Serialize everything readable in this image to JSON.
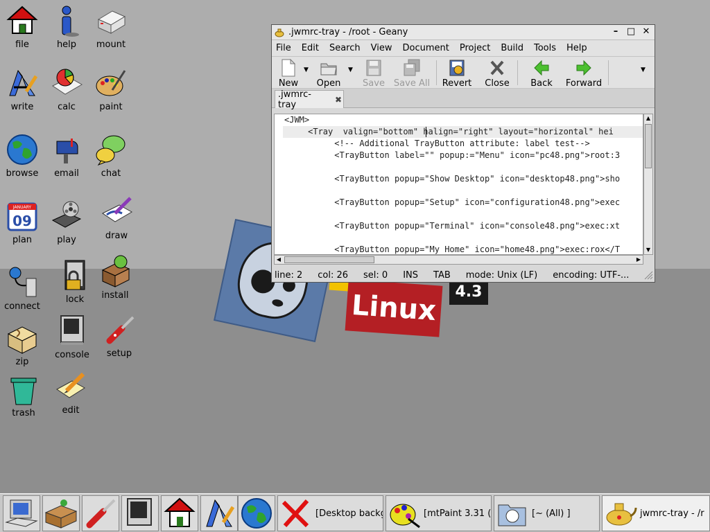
{
  "desktop": {
    "wallpaper": {
      "brand": "Linux",
      "version": "4.3"
    },
    "icons": [
      {
        "label": "file",
        "icon": "home-icon"
      },
      {
        "label": "help",
        "icon": "info-icon"
      },
      {
        "label": "mount",
        "icon": "drive-icon"
      },
      {
        "label": "write",
        "icon": "write-icon"
      },
      {
        "label": "calc",
        "icon": "calc-icon"
      },
      {
        "label": "paint",
        "icon": "palette-icon"
      },
      {
        "label": "browse",
        "icon": "globe-icon"
      },
      {
        "label": "email",
        "icon": "mailbox-icon"
      },
      {
        "label": "chat",
        "icon": "chat-bubble-icon"
      },
      {
        "label": "plan",
        "icon": "calendar-icon"
      },
      {
        "label": "play",
        "icon": "film-reel-icon"
      },
      {
        "label": "draw",
        "icon": "draw-icon"
      },
      {
        "label": "connect",
        "icon": "connect-icon"
      },
      {
        "label": "lock",
        "icon": "lock-icon"
      },
      {
        "label": "install",
        "icon": "install-icon"
      },
      {
        "label": "zip",
        "icon": "package-icon"
      },
      {
        "label": "console",
        "icon": "monitor-icon"
      },
      {
        "label": "setup",
        "icon": "knife-icon"
      },
      {
        "label": "trash",
        "icon": "trash-icon"
      },
      {
        "label": "edit",
        "icon": "edit-icon"
      }
    ],
    "calendar_date": "09",
    "calendar_month": "JANUARY"
  },
  "window": {
    "title": ".jwmrc-tray - /root - Geany",
    "menu": [
      "File",
      "Edit",
      "Search",
      "View",
      "Document",
      "Project",
      "Build",
      "Tools",
      "Help"
    ],
    "toolbar": {
      "new": "New",
      "open": "Open",
      "save": "Save",
      "save_all": "Save All",
      "revert": "Revert",
      "close": "Close",
      "back": "Back",
      "forward": "Forward"
    },
    "tab_label": ".jwmrc-tray",
    "editor_lines": [
      "<JWM>",
      "     <Tray  valign=\"bottom\" halign=\"right\" layout=\"horizontal\" hei",
      "          <!-- Additional TrayButton attribute: label test-->",
      "          <TrayButton label=\"\" popup:=\"Menu\" icon=\"pc48.png\">root:3",
      "",
      "          <TrayButton popup=\"Show Desktop\" icon=\"desktop48.png\">sho",
      "",
      "          <TrayButton popup=\"Setup\" icon=\"configuration48.png\">exec",
      "",
      "          <TrayButton popup=\"Terminal\" icon=\"console48.png\">exec:xt",
      "",
      "          <TrayButton popup=\"My Home\" icon=\"home48.png\">exec:rox</T"
    ],
    "status": {
      "line": "line: 2",
      "col": "col: 26",
      "sel": "sel: 0",
      "mode_ins": "INS",
      "tab": "TAB",
      "mode": "mode: Unix (LF)",
      "encoding": "encoding: UTF-..."
    }
  },
  "taskbar": {
    "launchers": [
      "computer-icon",
      "desk-icon",
      "knife-icon",
      "monitor-icon",
      "home-icon",
      "write-icon",
      "globe-icon"
    ],
    "tasks": [
      {
        "label": "[Desktop backg"
      },
      {
        "label": "[mtPaint 3.31 ("
      },
      {
        "label": "[~ (All) ]"
      },
      {
        "label": "jwmrc-tray - /r"
      }
    ]
  }
}
